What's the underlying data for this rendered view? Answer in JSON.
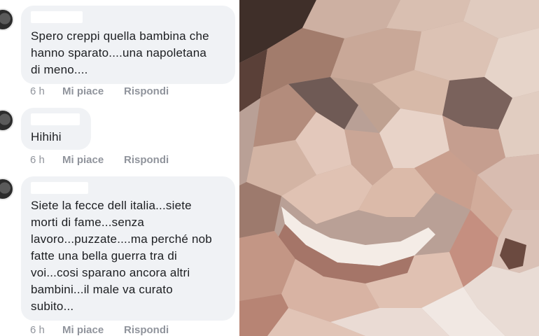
{
  "comments": [
    {
      "lines": [
        "Spero creppi quella bambina che",
        "hanno sparato....una napoletana",
        "di meno...."
      ],
      "time": "6 h",
      "like_label": "Mi piace",
      "reply_label": "Rispondi"
    },
    {
      "lines": [
        "Hihihi"
      ],
      "time": "6 h",
      "like_label": "Mi piace",
      "reply_label": "Rispondi"
    },
    {
      "lines": [
        "Siete la fecce dell italia...siete",
        "morti di fame...senza",
        "lavoro...puzzate....ma perché nob",
        "fatte una bella guerra tra di",
        "voi...cosi sparano ancora altri",
        "bambini...il male va curato",
        "subito..."
      ],
      "time": "6 h",
      "like_label": "Mi piace",
      "reply_label": "Rispondi"
    }
  ],
  "colors": {
    "bubble": "#f0f2f5",
    "action_text": "#90949c",
    "comment_text": "#1c1e21"
  }
}
